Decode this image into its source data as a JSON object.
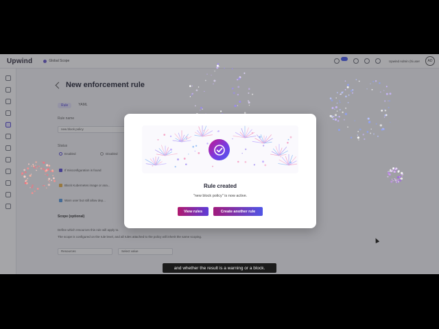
{
  "app": {
    "brand": "Upwind",
    "workspace": "Global Scope",
    "user": "Upwind Admin (hi.user",
    "avatar_initials": "AD",
    "notification_count": "",
    "accent_color": "#5a4fd8"
  },
  "sidebar": {
    "icons": [
      "home-icon",
      "plus-icon",
      "grid-icon",
      "shield-icon",
      "policy-icon",
      "layers-icon",
      "clock-icon",
      "user-icon",
      "list-icon",
      "link-icon",
      "settings-icon",
      "info-icon"
    ],
    "active_index": 4
  },
  "page": {
    "title": "New enforcement rule",
    "tabs": [
      "Rule",
      "YAML"
    ],
    "rule_name_label": "Rule name",
    "rule_name_value": "new block policy",
    "status_label": "Status",
    "status_enabled": "Enabled",
    "status_disabled": "Disabled",
    "condition_1": "If misconfiguration is found",
    "condition_2": "Block Kubernetes image or ana...",
    "condition_3": "Warn user but still allow dep...",
    "scope_label": "Scope (optional)",
    "scope_help_1": "Define which resources this rule will apply to.",
    "scope_help_2": "The scope is configured on the rule level, and all rules attached to the policy will inherit the same scoping.",
    "scope_field_1": "Resources",
    "scope_field_2": "Select value"
  },
  "modal": {
    "title": "Rule created",
    "subtitle": "\"new block policy\" is now active.",
    "view_rules_label": "View rules",
    "create_another_label": "Create another rule",
    "icon": "check-circle-icon"
  },
  "caption": {
    "text": "and whether the result is a warning or a block."
  }
}
